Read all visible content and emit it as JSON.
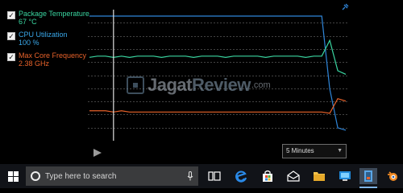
{
  "metrics": [
    {
      "label": "Package Temperature",
      "value": "67 °C",
      "color": "#3ad5a0",
      "checked": true
    },
    {
      "label": "CPU Utilization",
      "value": "100 %",
      "color": "#3aa8ea",
      "checked": true
    },
    {
      "label": "Max Core Frequency",
      "value": "2.38 GHz",
      "color": "#e8622a",
      "checked": true
    }
  ],
  "chart_data": {
    "type": "line",
    "title": "",
    "xlabel": "",
    "ylabel": "",
    "grid": true,
    "x": [
      0,
      10,
      20,
      30,
      40,
      50,
      60,
      70,
      80,
      90,
      100,
      110,
      120,
      130,
      140,
      150,
      160,
      170,
      180,
      190,
      200,
      210,
      220,
      230,
      240,
      250,
      260,
      270,
      280,
      290,
      300,
      310,
      320
    ],
    "ylim": [
      0,
      100
    ],
    "series": [
      {
        "values": [
          100,
          100,
          100,
          100,
          100,
          100,
          100,
          100,
          100,
          100,
          100,
          100,
          100,
          100,
          100,
          100,
          100,
          100,
          100,
          100,
          100,
          100,
          100,
          100,
          100,
          100,
          100,
          100,
          100,
          100,
          40,
          8,
          6
        ],
        "color": "#2f86d9"
      },
      {
        "values": [
          66,
          67,
          67,
          66,
          67,
          66,
          67,
          67,
          67,
          66,
          67,
          67,
          67,
          66,
          67,
          67,
          67,
          66,
          67,
          67,
          67,
          67,
          66,
          67,
          67,
          67,
          67,
          66,
          67,
          67,
          80,
          55,
          52
        ],
        "color": "#3ad5a0"
      },
      {
        "values": [
          22,
          22,
          22,
          21,
          22,
          21,
          21,
          21,
          21,
          21,
          21,
          21,
          21,
          21,
          21,
          21,
          21,
          21,
          21,
          21,
          21,
          21,
          21,
          21,
          21,
          21,
          21,
          21,
          21,
          21,
          20,
          32,
          30
        ],
        "color": "#e8622a"
      }
    ],
    "cursor_x": 30
  },
  "timeline": {
    "play_icon": "play-icon",
    "window_option": "5 Minutes"
  },
  "watermark": {
    "part1": "Jagat",
    "part2": "Review",
    "part3": ".com"
  },
  "taskbar": {
    "search_placeholder": "Type here to search",
    "icons": [
      "windows-logo-icon",
      "microphone-icon",
      "task-view-icon",
      "edge-browser-icon",
      "store-icon",
      "mail-icon",
      "file-explorer-icon",
      "remote-desktop-icon",
      "power-gadget-icon",
      "blender-icon"
    ]
  },
  "colors": {
    "accent_blue": "#2f86d9",
    "accent_green": "#3ad5a0",
    "accent_orange": "#e8622a"
  }
}
